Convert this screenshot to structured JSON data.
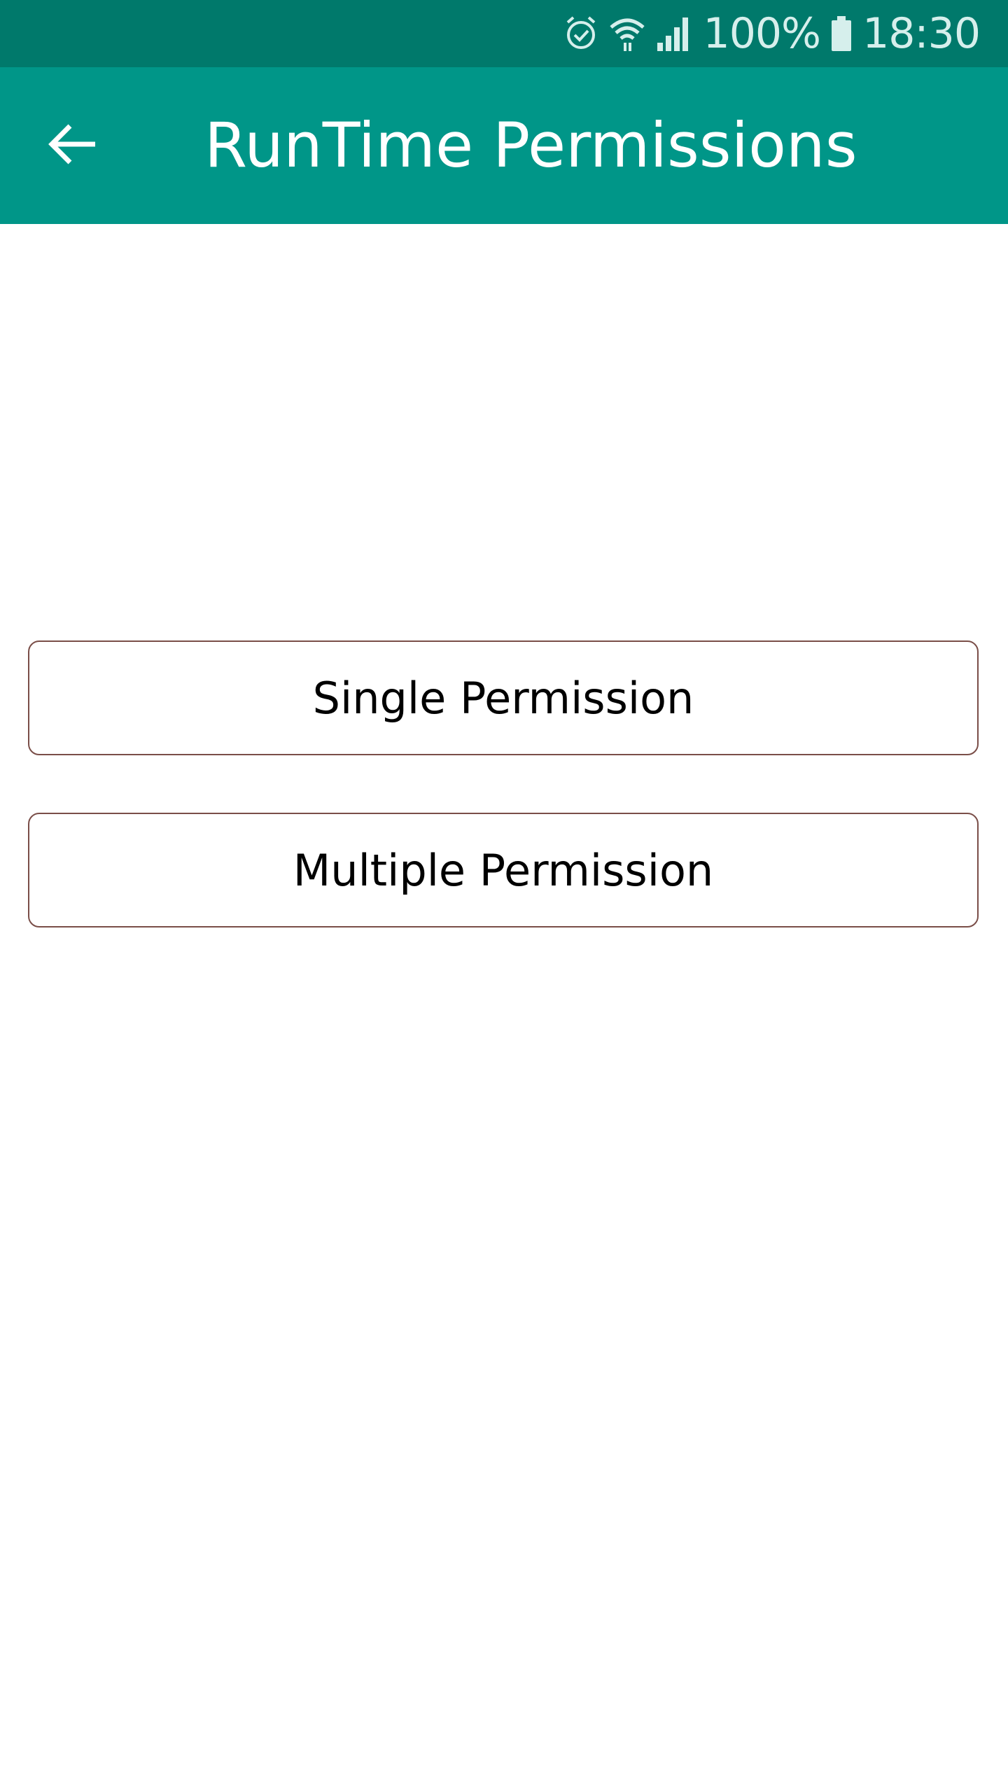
{
  "status_bar": {
    "icons": [
      "alarm-icon",
      "wifi-icon",
      "signal-icon",
      "battery-icon"
    ],
    "battery_text": "100%",
    "time": "18:30"
  },
  "toolbar": {
    "title": "RunTime Permissions",
    "back_icon": "arrow-back-icon",
    "color": "#009688"
  },
  "buttons": {
    "single_label": "Single Permission",
    "multiple_label": "Multiple Permission"
  },
  "colors": {
    "status_bar": "#00796B",
    "toolbar": "#009688",
    "button_border": "#7a4e48"
  }
}
